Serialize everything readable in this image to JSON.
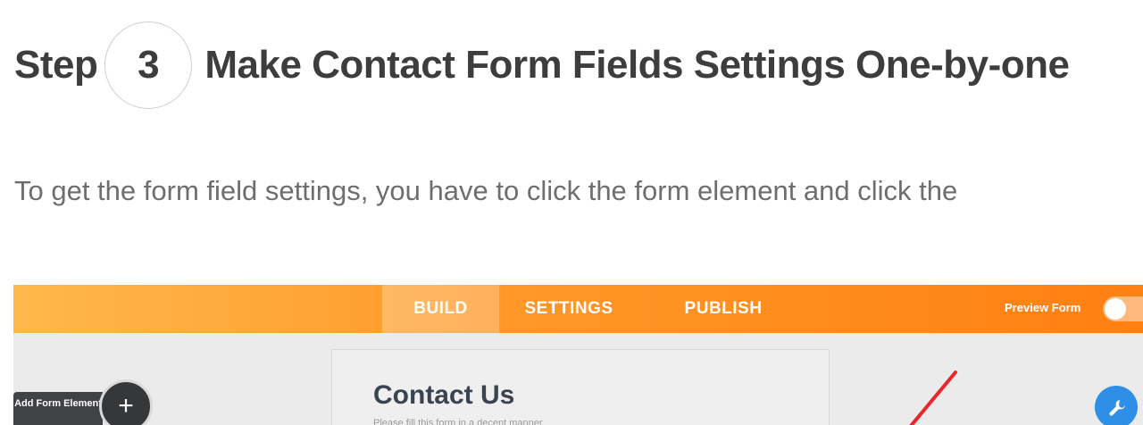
{
  "heading": {
    "step_word": "Step",
    "step_number": "3",
    "title": "Make Contact Form Fields Settings One-by-one"
  },
  "intro_text": "To get the form field settings, you have to click the form element and click the",
  "screenshot": {
    "tabs": [
      {
        "label": "BUILD",
        "active": true
      },
      {
        "label": "SETTINGS",
        "active": false
      },
      {
        "label": "PUBLISH",
        "active": false
      }
    ],
    "preview_label": "Preview Form",
    "form": {
      "title": "Contact Us",
      "subtitle": "Please fill this form in a decent manner"
    },
    "add_element": {
      "label": "Add Form Element",
      "icon": "plus-icon"
    },
    "edit_icon": "wrench-icon",
    "colors": {
      "topbar_start": "#ffb84d",
      "topbar_end": "#ff7f12",
      "annotation": "#e8262b",
      "edit_button": "#2d8fe6"
    }
  }
}
